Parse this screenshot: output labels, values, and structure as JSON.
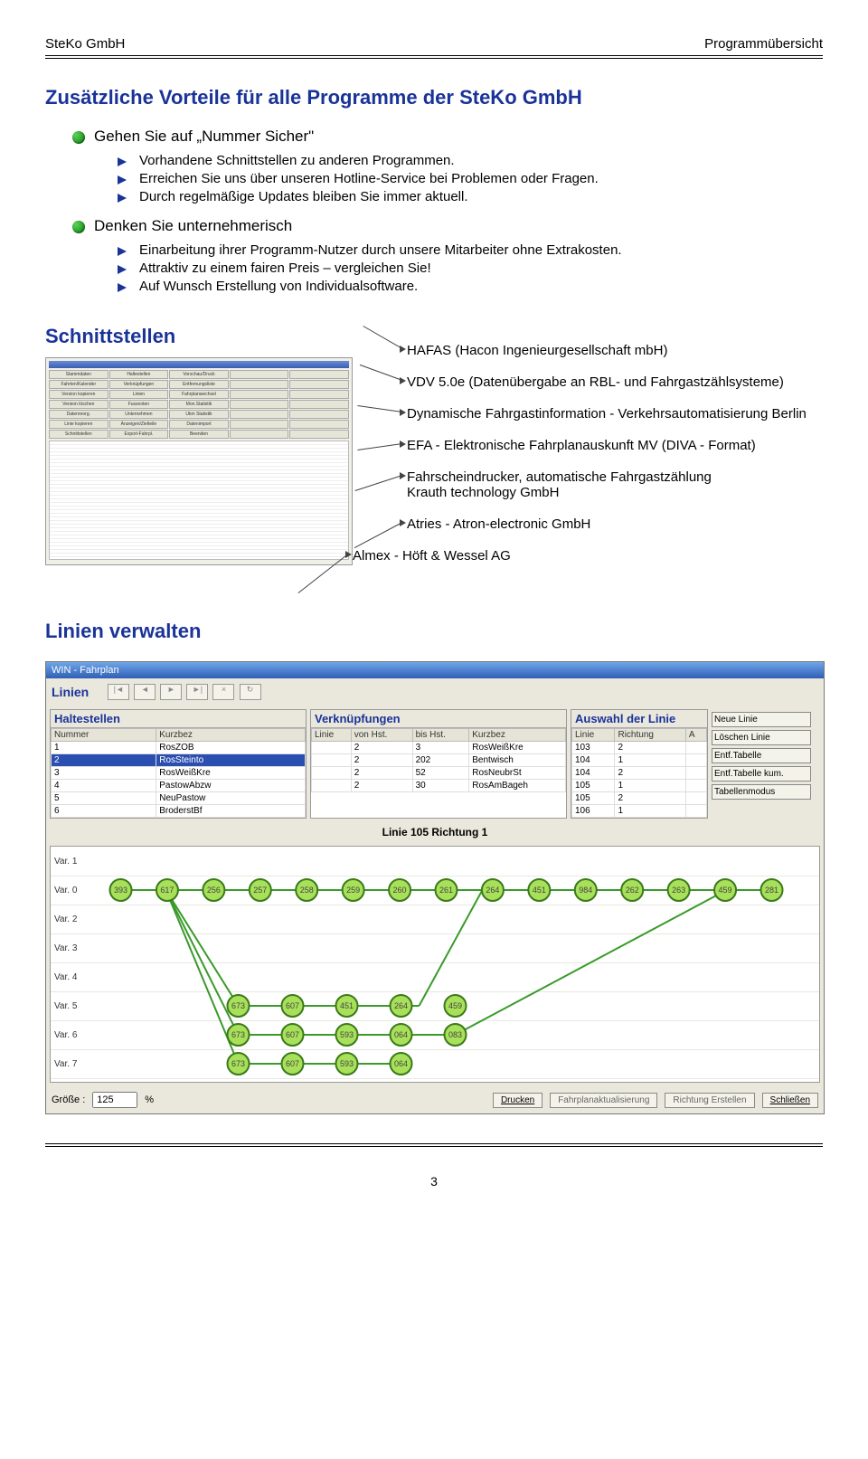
{
  "header": {
    "left": "SteKo GmbH",
    "right": "Programmübersicht"
  },
  "title": "Zusätzliche Vorteile für alle Programme der SteKo GmbH",
  "globe1": "Gehen Sie auf „Nummer Sicher\"",
  "sub1": [
    "Vorhandene Schnittstellen zu anderen Programmen.",
    "Erreichen Sie uns über unseren Hotline-Service bei Problemen oder Fragen.",
    "Durch regelmäßige Updates bleiben Sie immer aktuell."
  ],
  "globe2": "Denken Sie unternehmerisch",
  "sub2": [
    "Einarbeitung ihrer Programm-Nutzer durch unsere Mitarbeiter ohne Extrakosten.",
    "Attraktiv zu einem fairen Preis – vergleichen Sie!",
    "Auf Wunsch Erstellung von Individualsoftware."
  ],
  "section_schnitt": "Schnittstellen",
  "thumb": {
    "tbar": [
      "Stammdaten",
      "Haltestellen",
      "Vorschau/Druck",
      "",
      "",
      "Fahrten/Kalender",
      "Verknüpfungen",
      "Entfernungsliste",
      "",
      "",
      "Version kopieren",
      "Linien",
      "Fahrplanwechsel",
      "",
      "",
      "Version löschen",
      "Fussnoten",
      "Mon.Statistik",
      "",
      "",
      "Datenreorg.",
      "Unternehmen",
      "Ukm Statistik",
      "",
      "",
      "Linie kopieren",
      "Anzeigen/Zielteile",
      "Datenimport",
      "",
      "",
      "Schnittstellen",
      "Export-Fahrpl.",
      "Beenden",
      "",
      ""
    ]
  },
  "interfaces": [
    "HAFAS (Hacon Ingenieurgesellschaft mbH)",
    "VDV 5.0e (Datenübergabe an RBL- und Fahrgastzählsysteme)",
    "Dynamische Fahrgastinformation - Verkehrsautomatisierung Berlin",
    "EFA  - Elektronische Fahrplanauskunft MV (DIVA - Format)",
    "Fahrscheindrucker, automatische Fahrgastzählung\nKrauth technology GmbH",
    "Atries - Atron-electronic GmbH",
    "Almex - Höft & Wessel AG"
  ],
  "section_linien": "Linien verwalten",
  "linien": {
    "wintitle": "WIN - Fahrplan",
    "navlabel": "Linien",
    "navbtns": [
      "|◄",
      "◄",
      "►",
      "►|",
      "×",
      "↻"
    ],
    "panel_halt": {
      "title": "Haltestellen",
      "cols": [
        "Nummer",
        "Kurzbez"
      ],
      "rows": [
        [
          "1",
          "RosZOB"
        ],
        [
          "2",
          "RosSteinto"
        ],
        [
          "3",
          "RosWeißKre"
        ],
        [
          "4",
          "PastowAbzw"
        ],
        [
          "5",
          "NeuPastow"
        ],
        [
          "6",
          "BroderstBf"
        ]
      ],
      "selected": 1
    },
    "panel_verk": {
      "title": "Verknüpfungen",
      "cols": [
        "Linie",
        "von Hst.",
        "bis Hst.",
        "Kurzbez"
      ],
      "rows": [
        [
          "",
          "2",
          "3",
          "RosWeißKre"
        ],
        [
          "",
          "2",
          "202",
          "Bentwisch"
        ],
        [
          "",
          "2",
          "52",
          "RosNeubrSt"
        ],
        [
          "",
          "2",
          "30",
          "RosAmBageh"
        ]
      ]
    },
    "panel_ausw": {
      "title": "Auswahl der Linie",
      "cols": [
        "Linie",
        "Richtung",
        "A"
      ],
      "rows": [
        [
          "103",
          "2",
          ""
        ],
        [
          "104",
          "1",
          ""
        ],
        [
          "104",
          "2",
          ""
        ],
        [
          "105",
          "1",
          ""
        ],
        [
          "105",
          "2",
          ""
        ],
        [
          "106",
          "1",
          ""
        ]
      ]
    },
    "side_buttons": [
      "Neue Linie",
      "Löschen Linie",
      "Entf.Tabelle",
      "Entf.Tabelle kum.",
      "Tabellenmodus"
    ],
    "midlabel": "Linie 105  Richtung 1",
    "graph_rows": [
      "Var. 1",
      "Var. 0",
      "Var. 2",
      "Var. 3",
      "Var. 4",
      "Var. 5",
      "Var. 6",
      "Var. 7"
    ],
    "nodes_var0": [
      "393",
      "617",
      "256",
      "257",
      "258",
      "259",
      "260",
      "261",
      "264",
      "451",
      "984",
      "262",
      "263",
      "459",
      "281"
    ],
    "nodes_var5": [
      "673",
      "607",
      "451",
      "264",
      "459"
    ],
    "nodes_var6": [
      "673",
      "607",
      "593",
      "064",
      "083"
    ],
    "nodes_var7": [
      "673",
      "607",
      "593",
      "064"
    ],
    "bottom": {
      "label": "Größe :",
      "value": "125",
      "pct": "%",
      "btn_print": "Drucken",
      "btn_fahr": "Fahrplanaktualisierung",
      "btn_richt": "Richtung Erstellen",
      "btn_close": "Schließen"
    }
  },
  "pagenum": "3"
}
